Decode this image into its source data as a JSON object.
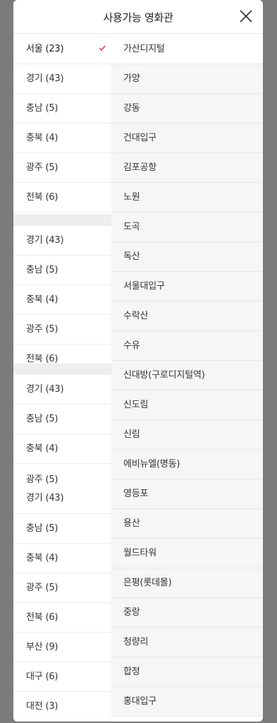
{
  "header": {
    "title": "사용가능 영화관",
    "close_icon": "close-icon"
  },
  "regions": [
    {
      "label": "서울 (23)",
      "selected": true
    },
    {
      "label": "경기 (43)"
    },
    {
      "label": "충남 (5)"
    },
    {
      "label": "충북 (4)"
    },
    {
      "label": "광주 (5)"
    },
    {
      "label": "전북 (6)"
    },
    {
      "label": "경기 (43)"
    },
    {
      "label": "충남 (5)"
    },
    {
      "label": "충북 (4)"
    },
    {
      "label": "광주 (5)"
    },
    {
      "label": "전북 (6)"
    },
    {
      "label": "경기 (43)"
    },
    {
      "label": "충남 (5)"
    },
    {
      "label": "충북 (4)"
    },
    {
      "label": "광주 (5)"
    },
    {
      "label": "경기 (43)"
    },
    {
      "label": "충남 (5)"
    },
    {
      "label": "충북 (4)"
    },
    {
      "label": "광주 (5)"
    },
    {
      "label": "전북 (6)"
    },
    {
      "label": "부산 (9)"
    },
    {
      "label": "대구 (6)"
    },
    {
      "label": "대전 (3)"
    }
  ],
  "theaters": [
    "가산디지털",
    "가양",
    "강동",
    "건대입구",
    "김포공항",
    "노원",
    "도곡",
    "독산",
    "서울대입구",
    "수락산",
    "수유",
    "신대방(구로디지털역)",
    "신도림",
    "신림",
    "에비뉴엘(명동)",
    "영등포",
    "용산",
    "월드타워",
    "은평(롯데몰)",
    "중랑",
    "청량리",
    "합정",
    "홍대입구"
  ],
  "colors": {
    "accent": "#e0284f",
    "overlay": "#7b7b7b"
  }
}
